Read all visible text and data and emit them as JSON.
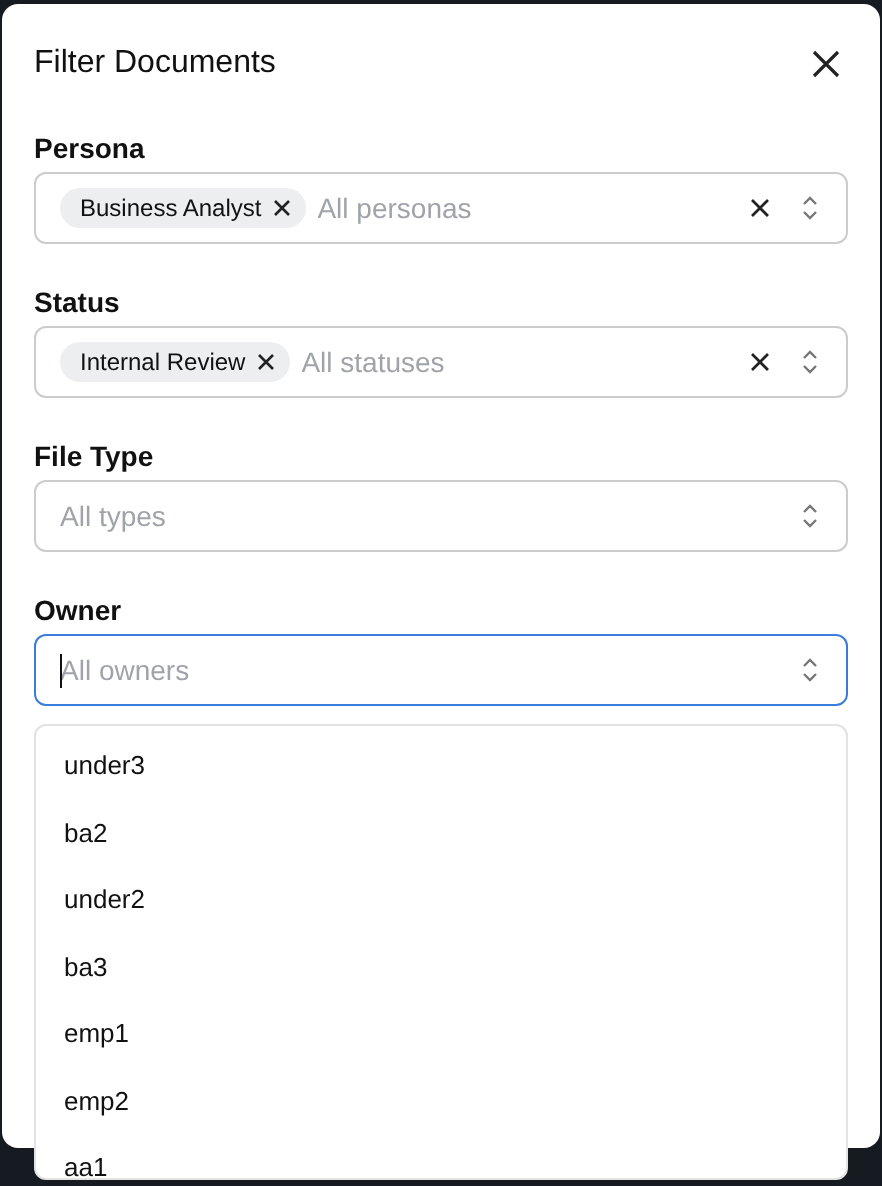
{
  "dialog": {
    "title": "Filter Documents"
  },
  "filters": [
    {
      "label": "Persona",
      "placeholder": "All personas",
      "chips": [
        "Business Analyst"
      ],
      "focused": false
    },
    {
      "label": "Status",
      "placeholder": "All statuses",
      "chips": [
        "Internal Review"
      ],
      "focused": false
    },
    {
      "label": "File Type",
      "placeholder": "All types",
      "focused": false
    },
    {
      "label": "Owner",
      "placeholder": "All owners",
      "focused": true
    }
  ],
  "dropdown": {
    "options": [
      "under3",
      "ba2",
      "under2",
      "ba3",
      "emp1",
      "emp2",
      "aa1"
    ]
  }
}
